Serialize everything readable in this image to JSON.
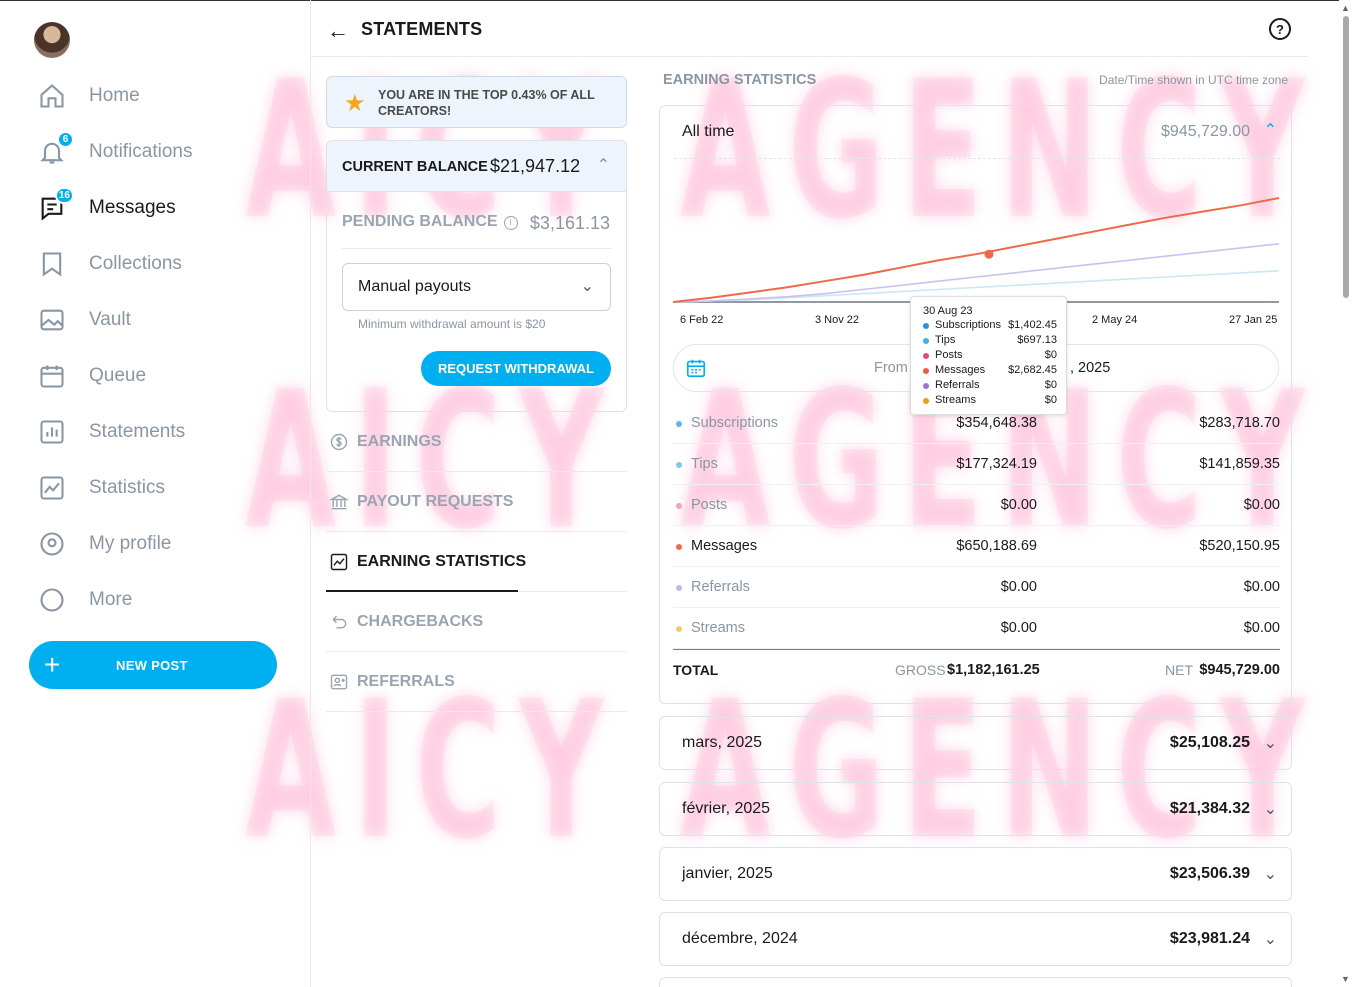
{
  "header": {
    "title": "STATEMENTS"
  },
  "sidebar": {
    "items": [
      {
        "label": "Home",
        "icon": "home-icon"
      },
      {
        "label": "Notifications",
        "icon": "bell-icon",
        "badge": "6"
      },
      {
        "label": "Messages",
        "icon": "message-icon",
        "badge": "16"
      },
      {
        "label": "Collections",
        "icon": "bookmark-icon"
      },
      {
        "label": "Vault",
        "icon": "image-icon"
      },
      {
        "label": "Queue",
        "icon": "calendar-icon"
      },
      {
        "label": "Statements",
        "icon": "bar-chart-icon"
      },
      {
        "label": "Statistics",
        "icon": "trend-icon"
      },
      {
        "label": "My profile",
        "icon": "user-circle-icon"
      },
      {
        "label": "More",
        "icon": "more-icon"
      }
    ],
    "new_post": "NEW POST"
  },
  "top_creator": "YOU ARE IN THE TOP 0.43% OF ALL CREATORS!",
  "balance": {
    "current_label": "CURRENT BALANCE",
    "current_value": "$21,947.12",
    "pending_label": "PENDING BALANCE",
    "pending_value": "$3,161.13",
    "payout_mode": "Manual payouts",
    "min_note": "Minimum withdrawal amount is $20",
    "request_button": "REQUEST WITHDRAWAL"
  },
  "menu": [
    {
      "label": "EARNINGS",
      "icon": "dollar-circle-icon"
    },
    {
      "label": "PAYOUT REQUESTS",
      "icon": "bank-icon"
    },
    {
      "label": "EARNING STATISTICS",
      "icon": "trend-icon"
    },
    {
      "label": "CHARGEBACKS",
      "icon": "undo-icon"
    },
    {
      "label": "REFERRALS",
      "icon": "user-plus-icon"
    }
  ],
  "earning_stats": {
    "title": "EARNING STATISTICS",
    "tz_note": "Date/Time shown in UTC time zone",
    "period_label": "All time",
    "period_total": "$945,729.00",
    "date_from_label": "From",
    "date_to_partial": ", 2025",
    "rows": [
      {
        "name": "Subscriptions",
        "gross": "$354,648.38",
        "net": "$283,718.70",
        "color": "#5bb8e8",
        "dark": false
      },
      {
        "name": "Tips",
        "gross": "$177,324.19",
        "net": "$141,859.35",
        "color": "#7fc8e8",
        "dark": false
      },
      {
        "name": "Posts",
        "gross": "$0.00",
        "net": "$0.00",
        "color": "#f4a3b5",
        "dark": false
      },
      {
        "name": "Messages",
        "gross": "$650,188.69",
        "net": "$520,150.95",
        "color": "#f06a4a",
        "dark": true
      },
      {
        "name": "Referrals",
        "gross": "$0.00",
        "net": "$0.00",
        "color": "#c7b3e6",
        "dark": false
      },
      {
        "name": "Streams",
        "gross": "$0.00",
        "net": "$0.00",
        "color": "#f6c86a",
        "dark": false
      }
    ],
    "total": {
      "label": "TOTAL",
      "gross_label": "GROSS",
      "gross": "$1,182,161.25",
      "net_label": "NET",
      "net": "$945,729.00"
    }
  },
  "tooltip": {
    "date": "30 Aug 23",
    "items": [
      {
        "name": "Subscriptions",
        "value": "$1,402.45",
        "color": "#2f8fd8"
      },
      {
        "name": "Tips",
        "value": "$697.13",
        "color": "#35b6e0"
      },
      {
        "name": "Posts",
        "value": "$0",
        "color": "#e8457a"
      },
      {
        "name": "Messages",
        "value": "$2,682.45",
        "color": "#f05a3c"
      },
      {
        "name": "Referrals",
        "value": "$0",
        "color": "#a070e0"
      },
      {
        "name": "Streams",
        "value": "$0",
        "color": "#f29a1a"
      }
    ]
  },
  "months": [
    {
      "month": "mars, 2025",
      "amount": "$25,108.25"
    },
    {
      "month": "février, 2025",
      "amount": "$21,384.32"
    },
    {
      "month": "janvier, 2025",
      "amount": "$23,506.39"
    },
    {
      "month": "décembre, 2024",
      "amount": "$23,981.24"
    }
  ],
  "watermark": {
    "text": "AICY AGENCY"
  },
  "chart_data": {
    "type": "line",
    "x_ticks": [
      "6 Feb 22",
      "3 Nov 22",
      "2 May 24",
      "27 Jan 25"
    ],
    "series": [
      {
        "name": "Messages",
        "color": "#f06a4a",
        "values": [
          0,
          0.04,
          0.09,
          0.14,
          0.2,
          0.26,
          0.33,
          0.4,
          0.46,
          0.53,
          0.6,
          0.67,
          0.74,
          0.81,
          0.87,
          0.93,
          1.0
        ]
      },
      {
        "name": "Subscriptions",
        "color": "#c9c2ee",
        "values": [
          0,
          0.01,
          0.03,
          0.05,
          0.08,
          0.12,
          0.16,
          0.2,
          0.24,
          0.28,
          0.32,
          0.36,
          0.4,
          0.44,
          0.48,
          0.52,
          0.56
        ]
      },
      {
        "name": "Tips",
        "color": "#cbe7f4",
        "values": [
          0,
          0.01,
          0.02,
          0.04,
          0.06,
          0.08,
          0.1,
          0.12,
          0.14,
          0.16,
          0.18,
          0.2,
          0.22,
          0.24,
          0.26,
          0.28,
          0.3
        ]
      }
    ],
    "highlight": {
      "series": "Messages",
      "date": "30 Aug 23"
    }
  }
}
